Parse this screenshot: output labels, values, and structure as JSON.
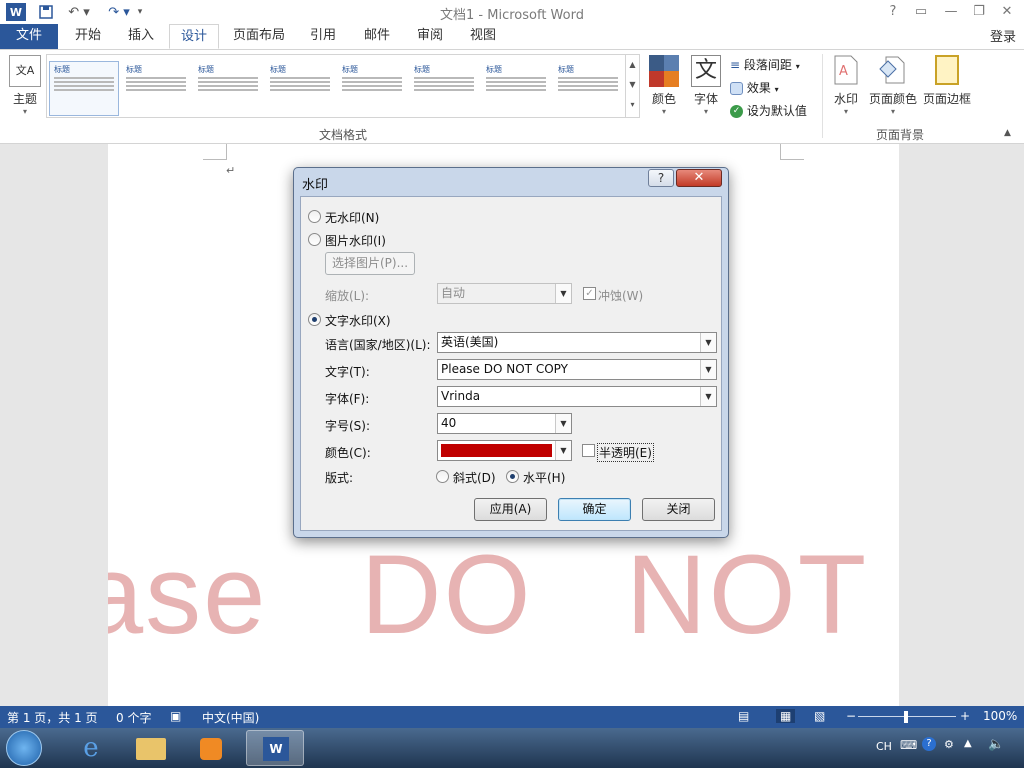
{
  "window": {
    "title": "文档1 - Microsoft Word",
    "controls": [
      "?",
      "□",
      "—",
      "□",
      "✕"
    ]
  },
  "tabs": [
    {
      "label": "文件"
    },
    {
      "label": "开始"
    },
    {
      "label": "插入"
    },
    {
      "label": "设计"
    },
    {
      "label": "页面布局"
    },
    {
      "label": "引用"
    },
    {
      "label": "邮件"
    },
    {
      "label": "审阅"
    },
    {
      "label": "视图"
    }
  ],
  "login_label": "登录",
  "ribbon": {
    "theme_label": "主题",
    "gallery_group": "文档格式",
    "gallery": [
      {
        "heading": "标题"
      },
      {
        "heading": "标题"
      },
      {
        "heading": "标题"
      },
      {
        "heading": "标题"
      },
      {
        "heading": "标题"
      },
      {
        "heading": "标题"
      },
      {
        "heading": "标题"
      },
      {
        "heading": "标题"
      }
    ],
    "colors_label": "颜色",
    "fonts_label": "字体",
    "font_glyph": "文",
    "paragraph_spacing": "段落间距",
    "effects": "效果",
    "set_default": "设为默认值",
    "bg_group": "页面背景",
    "watermark": "水印",
    "page_color": "页面颜色",
    "page_borders": "页面边框"
  },
  "document": {
    "watermark_text": "Please  DO  NOT  COPY",
    "para_mark": "↵"
  },
  "dialog": {
    "title": "水印",
    "no_watermark": "无水印(N)",
    "picture_watermark": "图片水印(I)",
    "select_picture": "选择图片(P)...",
    "scale_label": "缩放(L):",
    "scale_value": "自动",
    "washout": "冲蚀(W)",
    "text_watermark": "文字水印(X)",
    "language_label": "语言(国家/地区)(L):",
    "language_value": "英语(美国)",
    "text_label": "文字(T):",
    "text_value": "Please DO NOT COPY",
    "font_label": "字体(F):",
    "font_value": "Vrinda",
    "size_label": "字号(S):",
    "size_value": "40",
    "color_label": "颜色(C):",
    "color_value": "#c00000",
    "semitransparent": "半透明(E)",
    "layout_label": "版式:",
    "diagonal": "斜式(D)",
    "horizontal": "水平(H)",
    "apply": "应用(A)",
    "ok": "确定",
    "close": "关闭",
    "selected_option": "text_watermark",
    "selected_layout": "horizontal"
  },
  "statusbar": {
    "page": "第 1 页，共 1 页",
    "words": "0 个字",
    "language": "中文(中国)",
    "zoom": "100%"
  },
  "taskbar": {
    "ime": "CH"
  },
  "colors": {
    "word_blue": "#2b579a",
    "watermark": "#e7b3b3",
    "dialog_frame": "#c9d7ea"
  }
}
